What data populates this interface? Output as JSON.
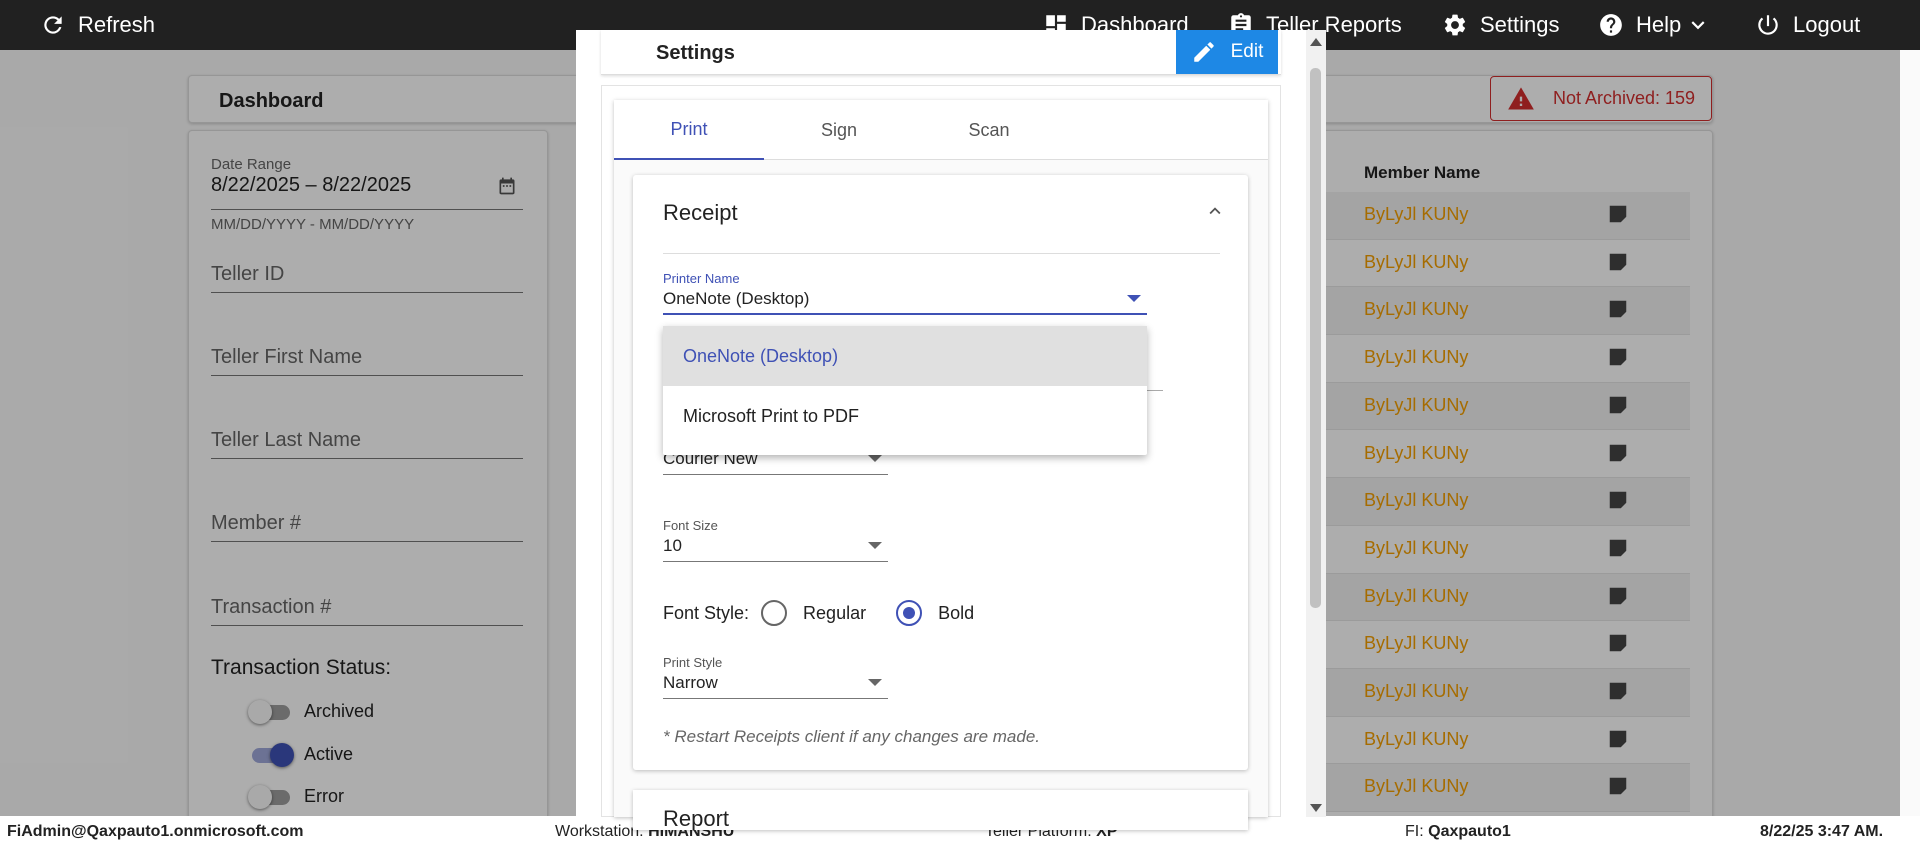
{
  "topbar": {
    "refresh": "Refresh",
    "dashboard": "Dashboard",
    "teller_reports": "Teller Reports",
    "settings": "Settings",
    "help": "Help",
    "logout": "Logout"
  },
  "page": {
    "title": "Dashboard",
    "not_archived": "Not Archived: 159"
  },
  "filters": {
    "date_range_label": "Date Range",
    "date_range_value": "8/22/2025 – 8/22/2025",
    "date_range_hint": "MM/DD/YYYY - MM/DD/YYYY",
    "teller_id": "Teller ID",
    "teller_first_name": "Teller First Name",
    "teller_last_name": "Teller Last Name",
    "member_number": "Member #",
    "transaction_number": "Transaction #",
    "status_title": "Transaction Status:",
    "statuses": [
      {
        "label": "Archived",
        "on": false
      },
      {
        "label": "Active",
        "on": true
      },
      {
        "label": "Error",
        "on": false
      }
    ]
  },
  "table": {
    "column_member_name": "Member Name",
    "rows": [
      "ByLyJl KUNy",
      "ByLyJl KUNy",
      "ByLyJl KUNy",
      "ByLyJl KUNy",
      "ByLyJl KUNy",
      "ByLyJl KUNy",
      "ByLyJl KUNy",
      "ByLyJl KUNy",
      "ByLyJl KUNy",
      "ByLyJl KUNy",
      "ByLyJl KUNy",
      "ByLyJl KUNy",
      "ByLyJl KUNy"
    ]
  },
  "modal": {
    "title": "Settings",
    "edit": "Edit",
    "tabs": [
      "Print",
      "Sign",
      "Scan"
    ],
    "active_tab": "Print",
    "receipt_title": "Receipt",
    "printer_name_label": "Printer Name",
    "printer_name_value": "OneNote (Desktop)",
    "printer_options": [
      "OneNote (Desktop)",
      "Microsoft Print to PDF"
    ],
    "font_value": "Courier New",
    "font_size_label": "Font Size",
    "font_size_value": "10",
    "font_style_label": "Font Style:",
    "font_style_options": [
      "Regular",
      "Bold"
    ],
    "font_style_selected": "Bold",
    "print_style_label": "Print Style",
    "print_style_value": "Narrow",
    "note": "* Restart Receipts client if any changes are made.",
    "report_title": "Report"
  },
  "footer": {
    "user": "FiAdmin@Qaxpauto1.onmicrosoft.com",
    "workstation_label": "Workstation:",
    "workstation_value": "HIMANSHU",
    "platform_label": "Teller Platform:",
    "platform_value": "XP",
    "fi_label": "FI:",
    "fi_value": "Qaxpauto1",
    "timestamp": "8/22/25 3:47 AM."
  },
  "colors": {
    "topbar": "#212121",
    "accent": "#3f51b5",
    "edit_button": "#1e88e5",
    "member_name": "#f5a000",
    "alert": "#d32f2f"
  }
}
